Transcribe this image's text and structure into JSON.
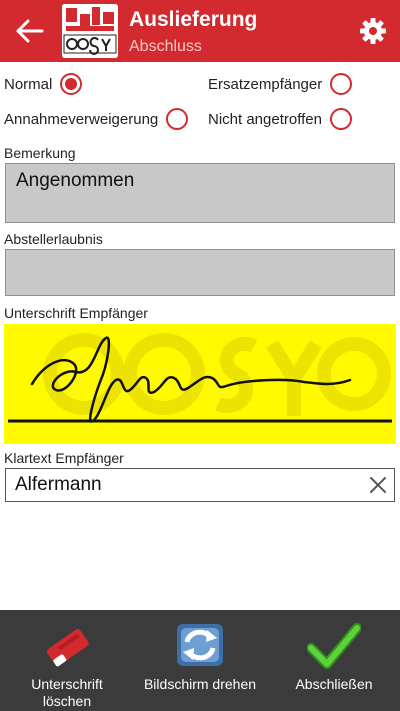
{
  "header": {
    "title": "Auslieferung",
    "subtitle": "Abschluss",
    "back_icon": "back-arrow-icon",
    "settings_icon": "gear-icon",
    "logo_icon": "cosys-logo-icon",
    "brand_color": "#d32a2f"
  },
  "delivery_options": [
    {
      "label": "Normal",
      "checked": true
    },
    {
      "label": "Ersatzempfänger",
      "checked": false
    },
    {
      "label": "Annahmeverweigerung",
      "checked": false
    },
    {
      "label": "Nicht angetroffen",
      "checked": false
    }
  ],
  "remark": {
    "label": "Bemerkung",
    "value": "Angenommen"
  },
  "storage_permission": {
    "label": "Abstellerlaubnis",
    "value": ""
  },
  "signature": {
    "label": "Unterschrift Empfänger",
    "background_color": "#fffa00"
  },
  "recipient_name": {
    "label": "Klartext Empfänger",
    "value": "Alfermann",
    "clear_icon": "close-icon"
  },
  "bottom_bar": {
    "delete_signature": {
      "label": "Unterschrift\nlöschen",
      "icon": "eraser-icon"
    },
    "rotate_screen": {
      "label": "Bildschirm drehen",
      "icon": "rotate-icon"
    },
    "finish": {
      "label": "Abschließen",
      "icon": "checkmark-icon"
    }
  }
}
